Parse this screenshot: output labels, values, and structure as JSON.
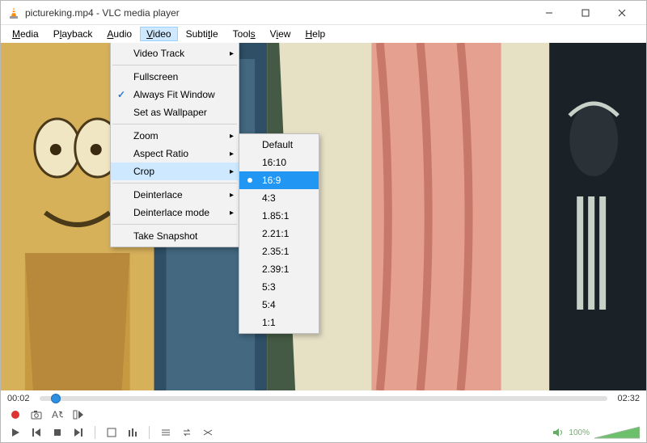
{
  "title": "pictureking.mp4 - VLC media player",
  "menubar": [
    "Media",
    "Playback",
    "Audio",
    "Video",
    "Subtitle",
    "Tools",
    "View",
    "Help"
  ],
  "active_menu_index": 3,
  "video_menu": {
    "video_track": "Video Track",
    "fullscreen": "Fullscreen",
    "always_fit": "Always Fit Window",
    "set_wallpaper": "Set as Wallpaper",
    "zoom": "Zoom",
    "aspect": "Aspect Ratio",
    "crop": "Crop",
    "deinterlace": "Deinterlace",
    "deinterlace_mode": "Deinterlace mode",
    "snapshot": "Take Snapshot"
  },
  "crop_menu": {
    "items": [
      "Default",
      "16:10",
      "16:9",
      "4:3",
      "1.85:1",
      "2.21:1",
      "2.35:1",
      "2.39:1",
      "5:3",
      "5:4",
      "1:1"
    ],
    "selected_index": 2
  },
  "timebar": {
    "current": "00:02",
    "total": "02:32",
    "progress_pct": 2
  },
  "volume": {
    "percent": "100%"
  }
}
